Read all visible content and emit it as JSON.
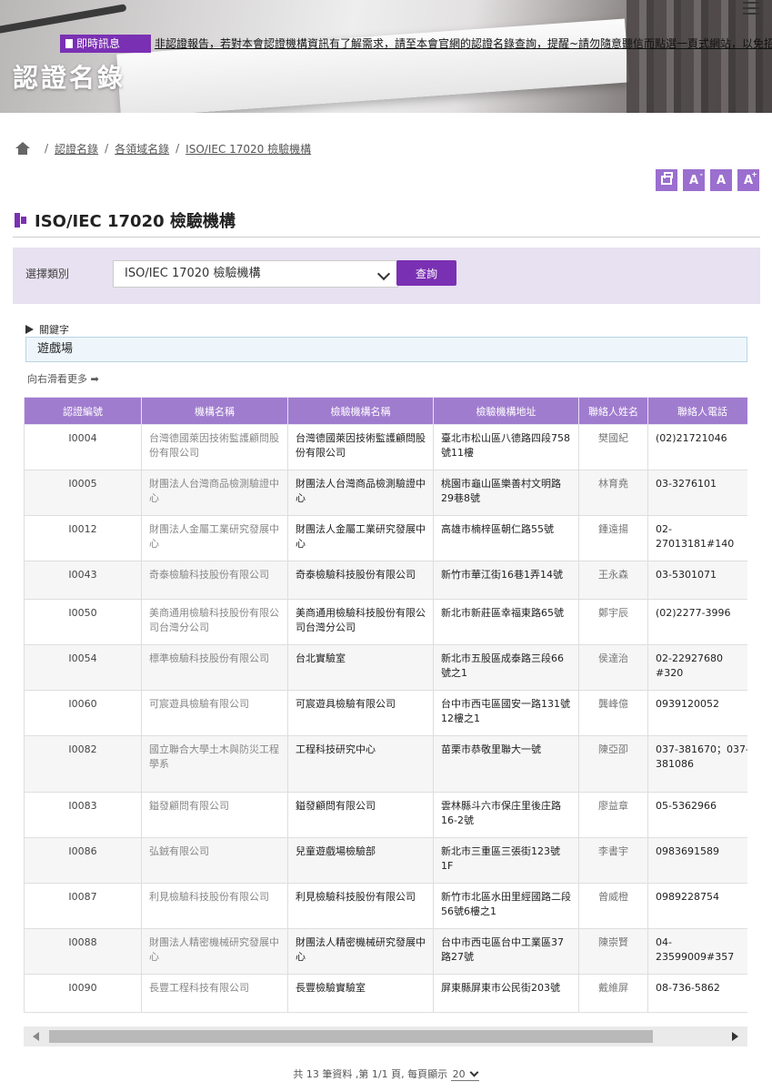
{
  "banner": {
    "title": "認證名錄",
    "ticker_label": "即時訊息",
    "ticker_text": "非認證報告，若對本會認證機構資訊有了解需求，請至本會官網的認證名錄查詢，提醒~請勿隨意聽信而點選一頁式網站，以免招"
  },
  "breadcrumb": {
    "items": [
      "認證名錄",
      "各領域名錄",
      "ISO/IEC 17020 檢驗機構"
    ]
  },
  "tools": {
    "font_small": "A",
    "font_medium": "A",
    "font_large": "A",
    "font_large_sup": "+",
    "font_small_sup": "-"
  },
  "page": {
    "title": "ISO/IEC 17020 檢驗機構"
  },
  "filter": {
    "label": "選擇類別",
    "selected": "ISO/IEC 17020 檢驗機構",
    "button": "查詢"
  },
  "keyword": {
    "label": "關鍵字",
    "value": "遊戲場"
  },
  "scroll_hint": "向右滑看更多 ➡",
  "table": {
    "headers": [
      "認證編號",
      "機構名稱",
      "檢驗機構名稱",
      "檢驗機構地址",
      "聯絡人姓名",
      "聯絡人電話"
    ],
    "rows": [
      {
        "code": "I0004",
        "org": "台灣德國萊因技術監護顧問股份有限公司",
        "name": "台灣德國萊因技術監護顧問股份有限公司",
        "addr": "臺北市松山區八德路四段758號11樓",
        "contact": "樊國紀",
        "phone": "(02)21721046"
      },
      {
        "code": "I0005",
        "org": "財團法人台灣商品檢測驗證中心",
        "name": "財團法人台灣商品檢測驗證中心",
        "addr": "桃園市龜山區樂善村文明路29巷8號",
        "contact": "林育堯",
        "phone": "03-3276101"
      },
      {
        "code": "I0012",
        "org": "財團法人金屬工業研究發展中心",
        "name": "財團法人金屬工業研究發展中心",
        "addr": "高雄市楠梓區朝仁路55號",
        "contact": "鍾遠揚",
        "phone": "02-27013181#140"
      },
      {
        "code": "I0043",
        "org": "奇泰檢驗科技股份有限公司",
        "name": "奇泰檢驗科技股份有限公司",
        "addr": "新竹市華江街16巷1弄14號",
        "contact": "王永森",
        "phone": "03-5301071"
      },
      {
        "code": "I0050",
        "org": "美商通用檢驗科技股份有限公司台灣分公司",
        "name": "美商通用檢驗科技股份有限公司台灣分公司",
        "addr": "新北市新莊區幸福東路65號",
        "contact": "鄭宇辰",
        "phone": "(02)2277-3996"
      },
      {
        "code": "I0054",
        "org": "標準檢驗科技股份有限公司",
        "name": "台北實驗室",
        "addr": "新北市五股區成泰路三段66號之1",
        "contact": "侯達治",
        "phone": "02-22927680 #320"
      },
      {
        "code": "I0060",
        "org": "可宸遊具檢驗有限公司",
        "name": "可宸遊具檢驗有限公司",
        "addr": "台中市西屯區國安一路131號12樓之1",
        "contact": "龔峰億",
        "phone": "0939120052"
      },
      {
        "code": "I0082",
        "org": "國立聯合大學土木與防災工程學系",
        "name": "工程科技研究中心",
        "addr": "苗栗市恭敬里聯大一號",
        "contact": "陳亞卲",
        "phone": "037-381670；037-381086"
      },
      {
        "code": "I0083",
        "org": "鎰發顧問有限公司",
        "name": "鎰發顧問有限公司",
        "addr": "雲林縣斗六市保庄里後庄路16-2號",
        "contact": "廖益章",
        "phone": "05-5362966"
      },
      {
        "code": "I0086",
        "org": "弘銊有限公司",
        "name": "兒童遊戲場檢驗部",
        "addr": "新北市三重區三張街123號1F",
        "contact": "李書宇",
        "phone": "0983691589"
      },
      {
        "code": "I0087",
        "org": "利見檢驗科技股份有限公司",
        "name": "利見檢驗科技股份有限公司",
        "addr": "新竹市北區水田里經國路二段56號6樓之1",
        "contact": "曾威橙",
        "phone": "0989228754"
      },
      {
        "code": "I0088",
        "org": "財團法人精密機械研究發展中心",
        "name": "財團法人精密機械研究發展中心",
        "addr": "台中市西屯區台中工業區37路27號",
        "contact": "陳崇賢",
        "phone": "04-23599009#357"
      },
      {
        "code": "I0090",
        "org": "長豐工程科技有限公司",
        "name": "長豐檢驗實驗室",
        "addr": "屏東縣屏東市公民街203號",
        "contact": "戴維屏",
        "phone": "08-736-5862"
      }
    ]
  },
  "pager": {
    "summary": "共 13 筆資料 ,第 1/1 頁, 每頁顯示",
    "per_page": "20"
  }
}
